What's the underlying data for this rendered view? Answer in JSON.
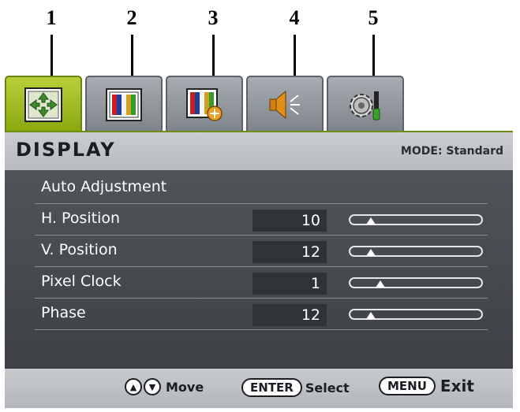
{
  "callouts": [
    "1",
    "2",
    "3",
    "4",
    "5"
  ],
  "tabs": [
    {
      "icon": "display-adjust-icon",
      "active": true
    },
    {
      "icon": "picture-icon",
      "active": false
    },
    {
      "icon": "picture-advanced-icon",
      "active": false
    },
    {
      "icon": "audio-speaker-icon",
      "active": false
    },
    {
      "icon": "system-settings-icon",
      "active": false
    }
  ],
  "header": {
    "title": "DISPLAY",
    "mode": "MODE: Standard"
  },
  "menu": {
    "auto_adjust_label": "Auto Adjustment",
    "items": [
      {
        "label": "H. Position",
        "value": "10",
        "level": 0.12
      },
      {
        "label": "V. Position",
        "value": "12",
        "level": 0.12
      },
      {
        "label": "Pixel Clock",
        "value": "1",
        "level": 0.2
      },
      {
        "label": "Phase",
        "value": "12",
        "level": 0.12
      }
    ]
  },
  "footer": {
    "up_icon": "up-arrow-icon",
    "down_icon": "down-arrow-icon",
    "move_label": "Move",
    "enter_key": "ENTER",
    "select_label": "Select",
    "menu_key": "MENU",
    "exit_label": "Exit"
  },
  "colors": {
    "active_tab": "#9cba1c",
    "inactive_tab": "#959aa0",
    "panel_body": "#474b50",
    "header_bg": "#c0c3c7"
  }
}
